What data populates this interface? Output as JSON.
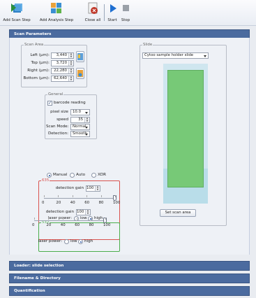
{
  "toolbar": {
    "add_scan_step": "Add Scan Step",
    "add_analysis_step": "Add Analysis Step",
    "close_all": "Close all",
    "start": "Start",
    "stop": "Stop"
  },
  "scan_parameters": {
    "title": "Scan Parameters",
    "scan_area": {
      "legend": "Scan Area",
      "left_label": "Left (µm):",
      "left_value": "3,440",
      "top_label": "Top (µm):",
      "top_value": "3,720",
      "right_label": "Right (µm):",
      "right_value": "22,280",
      "bottom_label": "Bottom (µm):",
      "bottom_value": "62,640"
    },
    "general": {
      "legend": "General",
      "barcode_label": "barcode reading",
      "barcode_checked": true,
      "pixel_size_label": "pixel size",
      "pixel_size_value": "10.0",
      "speed_label": "speed",
      "speed_value": "35",
      "scan_mode_label": "Scan Mode:",
      "scan_mode_value": "Normal",
      "detection_label": "Detection:",
      "detection_value": "Smooth"
    },
    "modes": {
      "manual": "Manual",
      "auto": "Auto",
      "xdr": "XDR",
      "selected": "Manual"
    },
    "ch635": {
      "legend": "635",
      "gain_label": "detection gain",
      "gain_value": "100",
      "scale": [
        "0",
        "20",
        "40",
        "60",
        "80",
        "100"
      ],
      "gain_fraction": 1.0,
      "laser_label": "laser power:",
      "low": "low",
      "high": "high",
      "laser_selected": "high",
      "color": "#d9534f"
    },
    "ch532": {
      "legend": "532",
      "gain_label": "detection gain",
      "gain_value": "100",
      "scale": [
        "0",
        "20",
        "40",
        "60",
        "80",
        "100"
      ],
      "gain_fraction": 1.0,
      "laser_label": "laser power:",
      "low": "low",
      "high": "high",
      "laser_selected": "high",
      "color": "#4cae4c"
    },
    "slide": {
      "legend": "Slide",
      "selected": "Cytoo sample holder slide",
      "set_scan_area": "Set scan area"
    }
  },
  "sections": {
    "loader": "Loader: slide selection",
    "filename": "Filename & Directory",
    "quantification": "Quantification"
  }
}
